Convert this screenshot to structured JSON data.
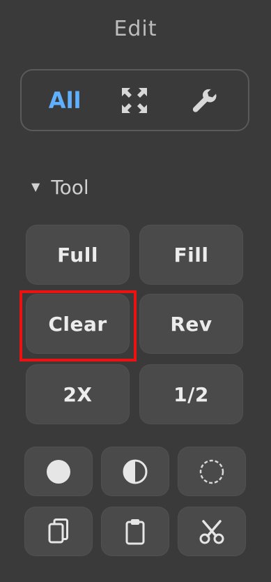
{
  "panel": {
    "title": "Edit",
    "segments": [
      {
        "label": "All",
        "icon": "text-label"
      },
      {
        "label": "",
        "icon": "expand-arrows-icon"
      },
      {
        "label": "",
        "icon": "wrench-icon"
      }
    ],
    "section_label": "Tool",
    "tool_buttons": [
      "Full",
      "Fill",
      "Clear",
      "Rev",
      "2X",
      "1/2"
    ],
    "icon_buttons": [
      "filled-circle-icon",
      "half-circle-icon",
      "dashed-circle-icon",
      "copy-icon",
      "clipboard-icon",
      "scissors-icon"
    ],
    "highlighted_button": "Clear",
    "colors": {
      "background": "#3a3a3a",
      "button": "#4a4a4a",
      "accent": "#5fb1ff",
      "highlight": "#ee1111"
    }
  }
}
